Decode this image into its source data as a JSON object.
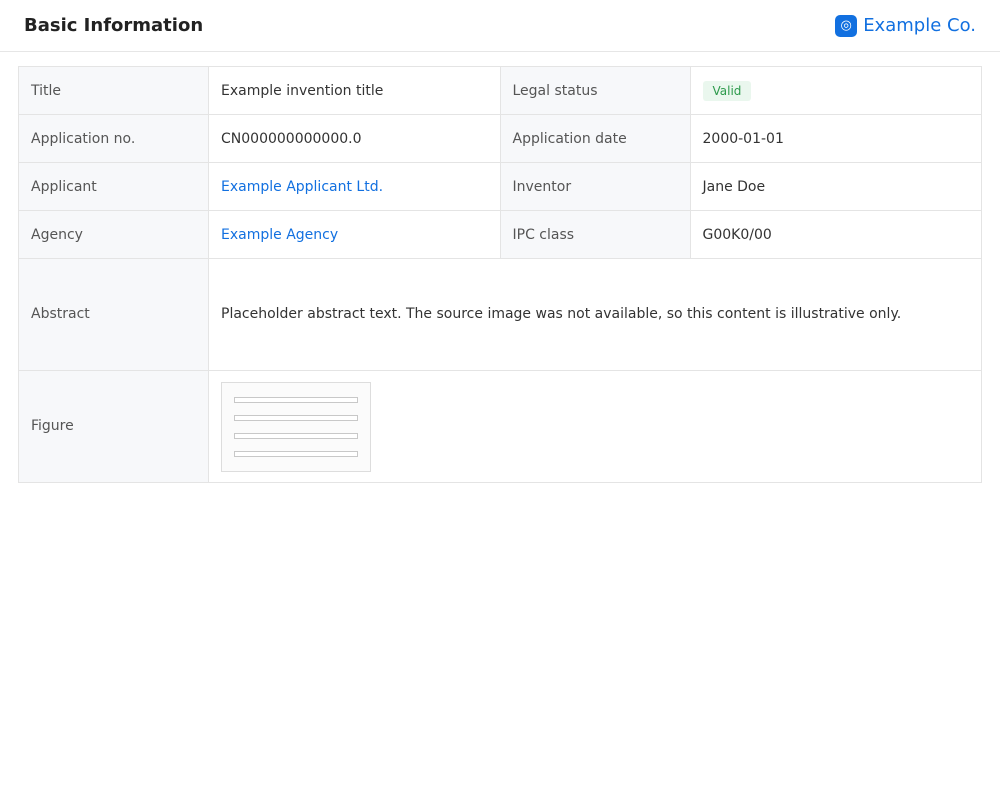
{
  "header": {
    "title": "Basic Information",
    "brand": "Example Co."
  },
  "rows": [
    {
      "label": "Title",
      "value": "Example invention title"
    },
    {
      "label": "Legal status",
      "badge": "Valid"
    },
    {
      "label": "Application no.",
      "value": "CN000000000000.0"
    },
    {
      "label": "Application date",
      "value": "2000-01-01"
    },
    {
      "label": "Applicant",
      "value": "Example Applicant Ltd.",
      "link": true
    },
    {
      "label": "Inventor",
      "value": "Jane Doe"
    },
    {
      "label": "Agency",
      "value": "Example Agency",
      "link": true
    },
    {
      "label": "IPC class",
      "value": "G00K0/00"
    }
  ],
  "abstract": {
    "label": "Abstract",
    "text": "Placeholder abstract text. The source image was not available, so this content is illustrative only."
  },
  "figure": {
    "label": "Figure"
  }
}
